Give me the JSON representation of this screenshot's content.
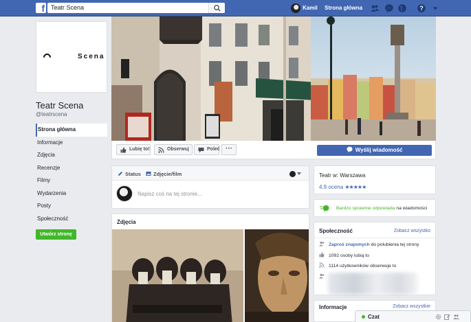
{
  "topbar": {
    "logo": "f",
    "search_value": "Teatr Scena",
    "user_name": "Kamil",
    "home_label": "Strona główna",
    "icons": [
      "friends-icon",
      "messenger-icon",
      "globe-icon",
      "help-icon",
      "caret-down-icon"
    ]
  },
  "page": {
    "profile_logo_text": "Scena",
    "name": "Teatr Scena",
    "handle": "@teatrscena"
  },
  "nav": {
    "items": [
      {
        "label": "Strona główna",
        "active": true
      },
      {
        "label": "Informacje"
      },
      {
        "label": "Zdjęcia"
      },
      {
        "label": "Recenzje"
      },
      {
        "label": "Filmy"
      },
      {
        "label": "Wydarzenia"
      },
      {
        "label": "Posty"
      },
      {
        "label": "Społeczność"
      }
    ],
    "create_label": "Utwórz stronę"
  },
  "actions": {
    "like": "Lubię to!",
    "follow": "Obserwuj",
    "share": "Poleć",
    "more": "···",
    "send_message": "Wyślij wiadomość"
  },
  "composer": {
    "status_tab": "Status",
    "photo_tab": "Zdjęcie/film",
    "placeholder": "Napisz coś na tej stronie..."
  },
  "photos": {
    "title": "Zdjęcia"
  },
  "about": {
    "location": "Teatr w: Warszawa",
    "rating_value": "4.9 ocena",
    "stars": "★★★★★",
    "response_fast": "Bardzo sprawnie odpowiada",
    "response_rest": "na wiadomości"
  },
  "community": {
    "title": "Społeczność",
    "see_all": "Zobacz wszystko",
    "invite_link": "Zaproś znajomych",
    "invite_rest": "do polubienia tej strony",
    "likes": "1092 osoby lubią to",
    "followers": "1114 użytkowników obserwuje to"
  },
  "info": {
    "title": "Informacje",
    "see_all": "Zobacz wszystkie"
  },
  "chat": {
    "label": "Czat"
  },
  "colors": {
    "brand": "#4267b2",
    "green": "#42b72a",
    "background": "#e9ebee"
  }
}
